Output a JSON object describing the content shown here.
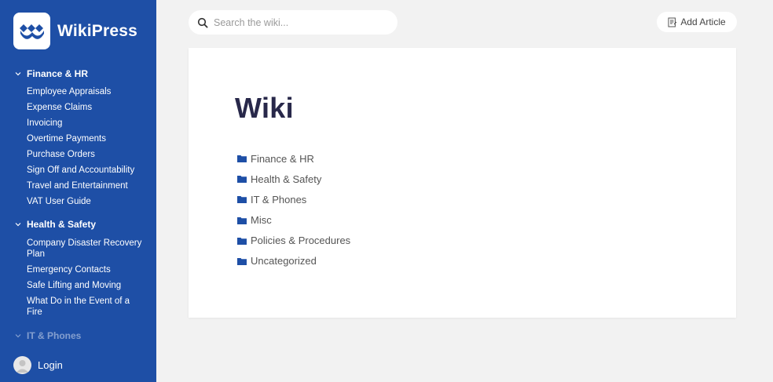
{
  "brand": {
    "name": "WikiPress",
    "logo_icon": "wikipress-logo-icon",
    "accent": "#1e4fa6"
  },
  "sidebar": {
    "categories": [
      {
        "label": "Finance & HR",
        "expanded": true,
        "items": [
          "Employee Appraisals",
          "Expense Claims",
          "Invoicing",
          "Overtime Payments",
          "Purchase Orders",
          "Sign Off and Accountability",
          "Travel and Entertainment",
          "VAT User Guide"
        ]
      },
      {
        "label": "Health & Safety",
        "expanded": true,
        "items": [
          "Company Disaster Recovery Plan",
          "Emergency Contacts",
          "Safe Lifting and Moving",
          "What Do in the Event of a Fire"
        ]
      },
      {
        "label": "IT & Phones",
        "expanded": true,
        "items": []
      }
    ],
    "login_label": "Login"
  },
  "search": {
    "placeholder": "Search the wiki..."
  },
  "toolbar": {
    "add_article_label": "Add Article"
  },
  "main": {
    "title": "Wiki",
    "categories": [
      "Finance & HR",
      "Health & Safety",
      "IT & Phones",
      "Misc",
      "Policies & Procedures",
      "Uncategorized"
    ]
  }
}
